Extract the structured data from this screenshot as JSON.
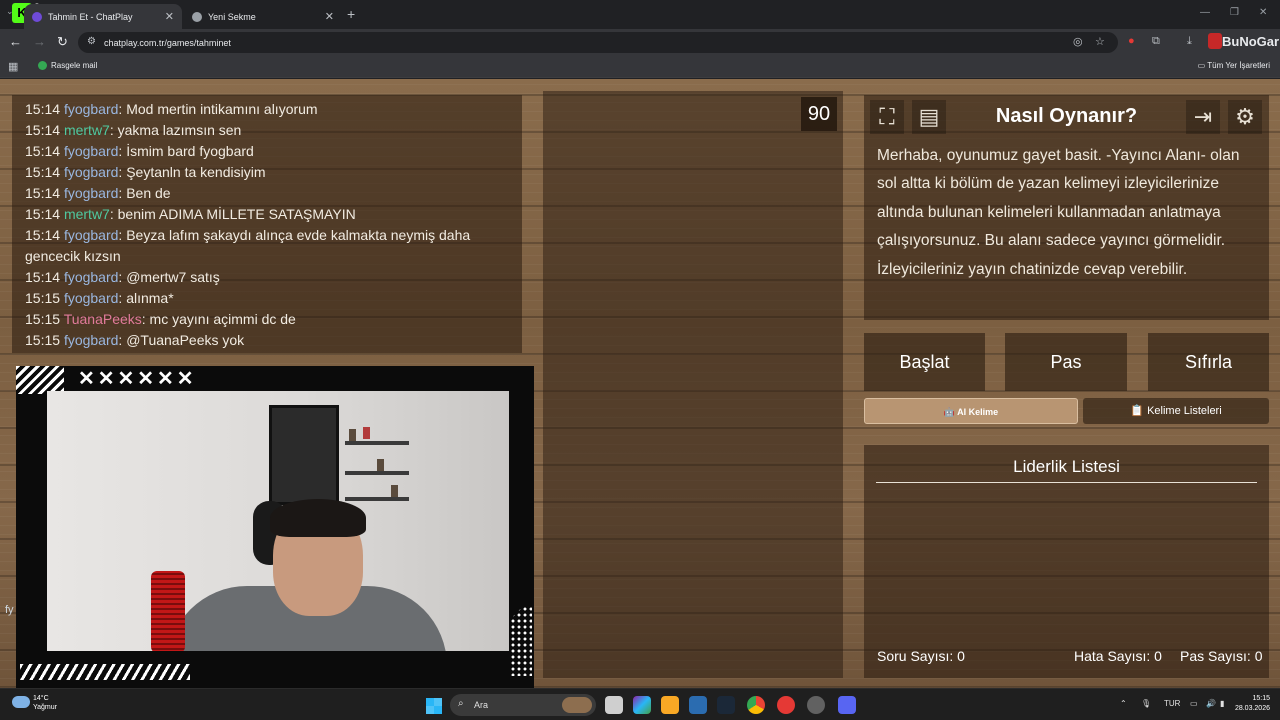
{
  "browser": {
    "kick_badge": "K",
    "kick_count": "9",
    "tabs": [
      {
        "label": "Tahmin Et - ChatPlay"
      },
      {
        "label": "Yeni Sekme"
      }
    ],
    "url": "chatplay.com.tr/games/tahminet",
    "extension_brand": "BuNoGar",
    "bookmark": "Rasgele mail",
    "all_bookmarks": "Tüm Yer İşaretleri"
  },
  "chat": {
    "messages": [
      {
        "time": "15:14",
        "user": "fyogbard",
        "color": "#9ab7e0",
        "text": ": Mod mertin intikamını alıyorum"
      },
      {
        "time": "15:14",
        "user": "mertw7",
        "color": "#4fc9a0",
        "text": ": yakma lazımsın sen"
      },
      {
        "time": "15:14",
        "user": "fyogbard",
        "color": "#9ab7e0",
        "text": ": İsmim bard fyogbard"
      },
      {
        "time": "15:14",
        "user": "fyogbard",
        "color": "#9ab7e0",
        "text": ": Şeytanln ta kendisiyim"
      },
      {
        "time": "15:14",
        "user": "fyogbard",
        "color": "#9ab7e0",
        "text": ": Ben de"
      },
      {
        "time": "15:14",
        "user": "mertw7",
        "color": "#4fc9a0",
        "text": ": benim ADIMA MİLLETE SATAŞMAYIN"
      },
      {
        "time": "15:14",
        "user": "fyogbard",
        "color": "#9ab7e0",
        "text": ": Beyza lafım şakaydı alınça evde kalmakta neymiş daha gencecik kızsın"
      },
      {
        "time": "15:14",
        "user": "fyogbard",
        "color": "#9ab7e0",
        "text": ": @mertw7 satış"
      },
      {
        "time": "15:15",
        "user": "fyogbard",
        "color": "#9ab7e0",
        "text": ": alınma*"
      },
      {
        "time": "15:15",
        "user": "TuanaPeeks",
        "color": "#e07a9a",
        "text": ": mc yayını açimmi dc de"
      },
      {
        "time": "15:15",
        "user": "fyogbard",
        "color": "#9ab7e0",
        "text": ": @TuanaPeeks yok"
      }
    ]
  },
  "webcam": {
    "x_marks": "✕✕✕✕✕✕",
    "side_text": "fy"
  },
  "game": {
    "timer": "90",
    "howto": {
      "title": "Nasıl Oynanır?",
      "text": "Merhaba, oyunumuz gayet basit. -Yayıncı Alanı- olan sol altta ki bölüm de yazan kelimeyi izleyicilerinize altında bulunan kelimeleri kullanmadan anlatmaya çalışıyorsunuz. Bu alanı sadece yayıncı görmelidir. İzleyicileriniz yayın chatinizde cevap verebilir."
    },
    "buttons": {
      "start": "Başlat",
      "pass": "Pas",
      "reset": "Sıfırla",
      "ai_word": "🤖 AI Kelime",
      "word_lists": "📋 Kelime Listeleri"
    },
    "leaderboard": {
      "title": "Liderlik Listesi",
      "questions": "Soru Sayısı: 0",
      "errors": "Hata Sayısı: 0",
      "passes": "Pas Sayısı: 0"
    }
  },
  "taskbar": {
    "temp": "14°C",
    "weather": "Yağmur",
    "search": "Ara",
    "lang": "TUR",
    "time": "15:15",
    "date": "28.03.2026"
  }
}
